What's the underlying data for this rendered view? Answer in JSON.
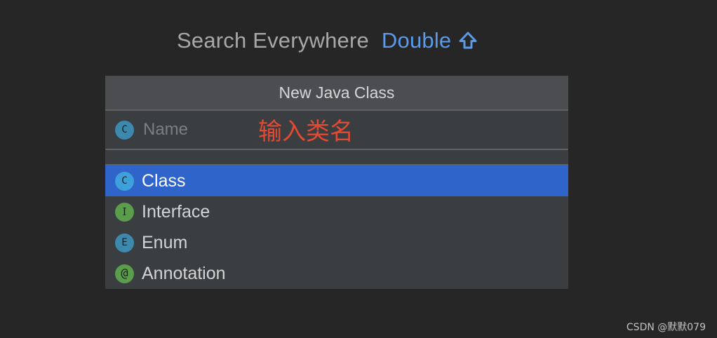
{
  "hint": {
    "text": "Search Everywhere",
    "shortcut": "Double",
    "shortcut_icon": "shift-arrow-icon",
    "color_text": "#a8a8a8",
    "color_shortcut": "#5a9ae8"
  },
  "dialog": {
    "title": "New Java Class",
    "name_field": {
      "placeholder": "Name",
      "value": "",
      "icon_letter": "C"
    },
    "annotation": "输入类名",
    "kinds": [
      {
        "icon_letter": "C",
        "label": "Class",
        "selected": true
      },
      {
        "icon_letter": "I",
        "label": "Interface",
        "selected": false
      },
      {
        "icon_letter": "E",
        "label": "Enum",
        "selected": false
      },
      {
        "icon_letter": "@",
        "label": "Annotation",
        "selected": false
      }
    ],
    "selection_color": "#2f65ca"
  },
  "watermark": "CSDN @默默079"
}
